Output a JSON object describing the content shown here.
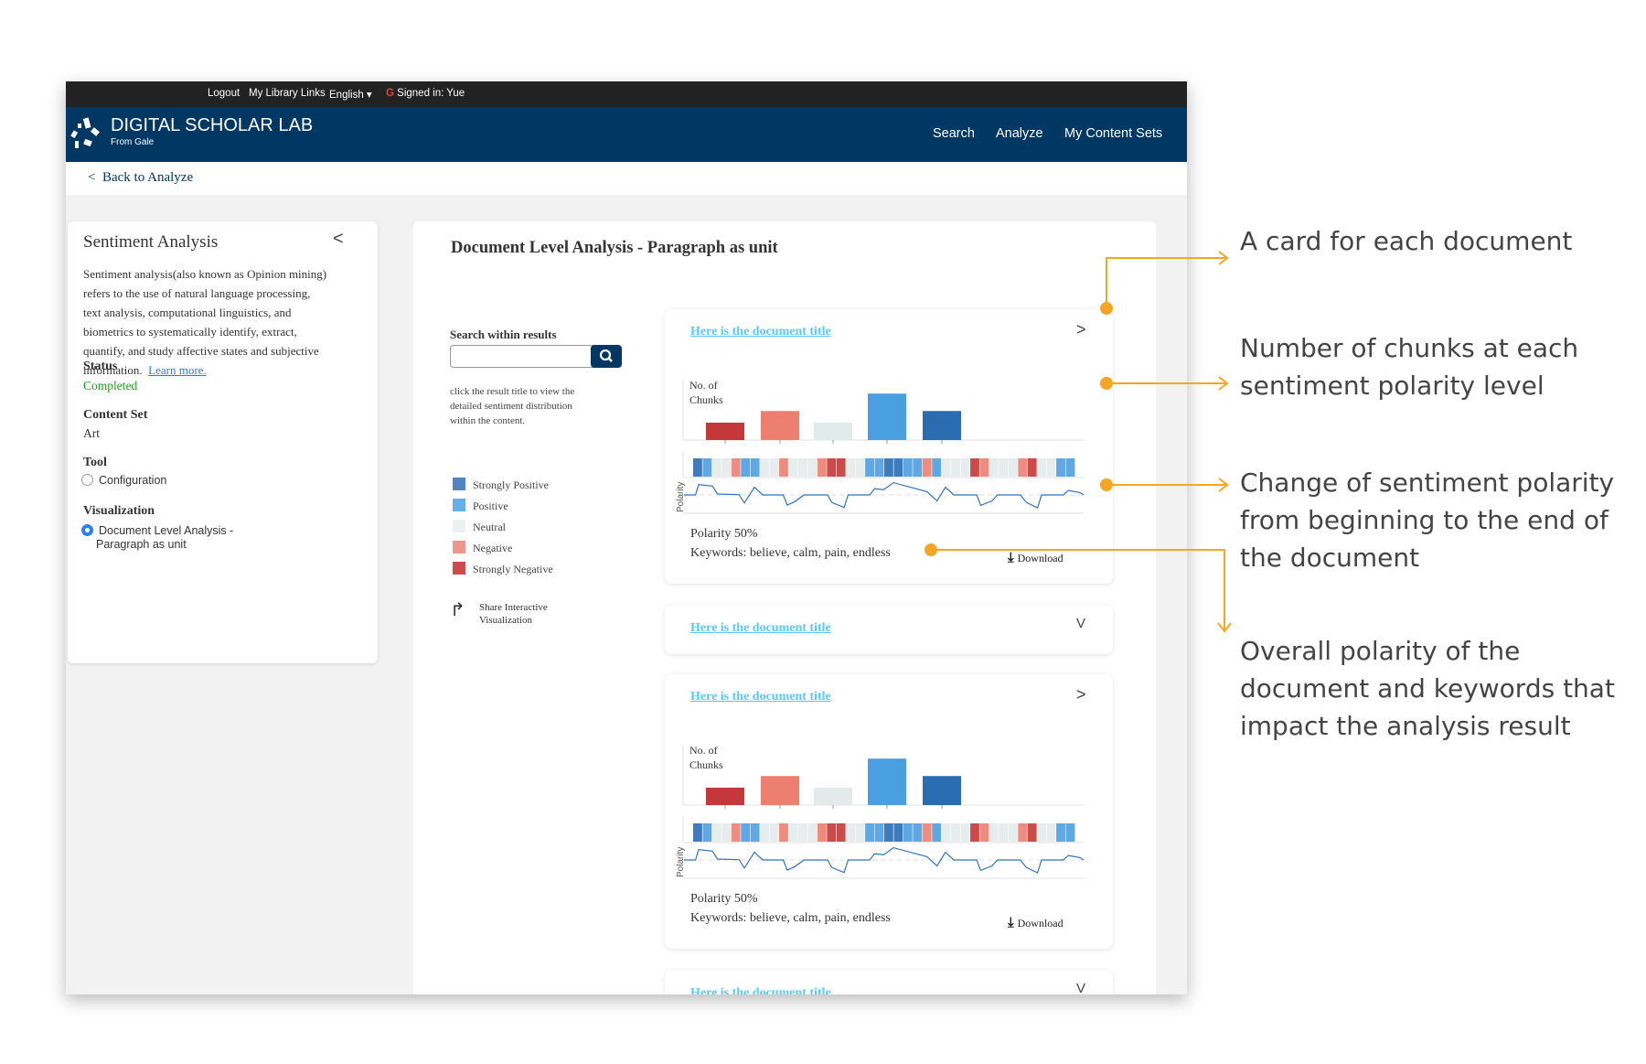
{
  "topbar": {
    "logout": "Logout",
    "library_links": "My Library Links",
    "language": "English",
    "signed_in": "Signed in: Yue"
  },
  "header": {
    "brand": "DIGITAL SCHOLAR LAB",
    "sub": "From Gale",
    "nav": [
      "Search",
      "Analyze",
      "My Content Sets"
    ]
  },
  "back": {
    "label": "Back to Analyze",
    "icon": "chevron-left-icon"
  },
  "left_panel": {
    "title": "Sentiment Analysis",
    "description_lines": [
      "Sentiment analysis(also known as Opinion mining)",
      "refers to the use of natural language processing,",
      "text analysis, computational linguistics, and",
      "biometrics to systematically identify, extract,",
      "quantify, and study affective states and subjective",
      "information."
    ],
    "learn_more": "Learn more.",
    "status_label": "Status",
    "status_value": "Completed",
    "status_color": "#1a9e1a",
    "content_set_label": "Content Set",
    "content_set_value": "Art",
    "tool_label": "Tool",
    "tool_option": "Configuration",
    "visualization_label": "Visualization",
    "visualization_option_line1": "Document Level Analysis -",
    "visualization_option_line2": "Paragraph as unit"
  },
  "main": {
    "title": "Document Level Analysis - Paragraph as unit",
    "search_label": "Search within results",
    "search_value": "",
    "search_placeholder": "",
    "help_lines": [
      "click the result title to view the",
      "detailed sentiment distribution",
      "within the content."
    ],
    "legend": [
      {
        "label": "Strongly Positive",
        "color": "#4f86c2"
      },
      {
        "label": "Positive",
        "color": "#66b0ea"
      },
      {
        "label": "Neutral",
        "color": "#ebf0f0"
      },
      {
        "label": "Negative",
        "color": "#f0958a"
      },
      {
        "label": "Strongly Negative",
        "color": "#cc4b4b"
      }
    ],
    "share_line1": "Share Interactive",
    "share_line2": "Visualization"
  },
  "documents": [
    {
      "title": "Here is the document title",
      "expanded": true,
      "chevron": ">",
      "polarity": "Polarity 50%",
      "keywords": "Keywords: believe, calm, pain, endless",
      "download": "Download"
    },
    {
      "title": "Here is the document title",
      "expanded": false,
      "chevron": "V"
    },
    {
      "title": "Here is the document title",
      "expanded": true,
      "chevron": ">",
      "polarity": "Polarity 50%",
      "keywords": "Keywords: believe, calm, pain, endless",
      "download": "Download"
    },
    {
      "title": "Here is the document title",
      "expanded": false,
      "chevron": "V"
    }
  ],
  "chart_data": [
    {
      "type": "bar",
      "ylabel": "No. of Chunks",
      "categories": [
        "Strongly Negative",
        "Negative",
        "Neutral",
        "Positive",
        "Strongly Positive"
      ],
      "values": [
        3,
        5,
        3,
        8,
        5
      ],
      "colors": [
        "#c4373a",
        "#ec7f6f",
        "#e2eaea",
        "#4a9fe0",
        "#2a6cb0"
      ]
    },
    {
      "type": "heatmap",
      "categories": [
        "SP",
        "P",
        "N",
        "N",
        "Neg",
        "P",
        "P",
        "N",
        "N",
        "Neg",
        "N",
        "N",
        "N",
        "Neg",
        "SN",
        "SN",
        "N",
        "N",
        "P",
        "P",
        "SP",
        "SP",
        "P",
        "P",
        "Neg",
        "P",
        "N",
        "N",
        "N",
        "SN",
        "Neg",
        "N",
        "N",
        "N",
        "Neg",
        "SN",
        "N",
        "N",
        "P",
        "P"
      ],
      "colors": {
        "SP": "#3f7cbc",
        "P": "#5fa8e3",
        "N": "#e7eded",
        "Neg": "#ef8c80",
        "SN": "#cc4a4a"
      }
    },
    {
      "type": "line",
      "ylabel": "Polarity",
      "ylim": [
        -1.2,
        1.2
      ],
      "color": "#2f72c0",
      "points": [
        [
          0.2,
          0
        ],
        [
          3.1,
          0
        ],
        [
          3.9,
          0.88
        ],
        [
          7.3,
          0.75
        ],
        [
          8.6,
          0.08
        ],
        [
          14,
          0.02
        ],
        [
          15.3,
          -0.68
        ],
        [
          17.8,
          0.65
        ],
        [
          19.9,
          0
        ],
        [
          25,
          0
        ],
        [
          26,
          -0.85
        ],
        [
          27.7,
          -0.6
        ],
        [
          30.2,
          0
        ],
        [
          36.1,
          0
        ],
        [
          37.1,
          -0.63
        ],
        [
          40.2,
          -1.05
        ],
        [
          41.2,
          0
        ],
        [
          46.6,
          0
        ],
        [
          47.8,
          0.53
        ],
        [
          50.1,
          0.45
        ],
        [
          52.5,
          1.03
        ],
        [
          60.9,
          0.28
        ],
        [
          63.4,
          -0.5
        ],
        [
          65.5,
          0.65
        ],
        [
          67.6,
          0
        ],
        [
          73.3,
          0
        ],
        [
          74.3,
          -0.88
        ],
        [
          77.1,
          -0.5
        ],
        [
          78.5,
          0
        ],
        [
          84.2,
          0
        ],
        [
          85.7,
          -0.63
        ],
        [
          88.5,
          -1.08
        ],
        [
          89.5,
          0
        ],
        [
          94.9,
          0
        ],
        [
          96.2,
          0.38
        ],
        [
          99.1,
          0.2
        ],
        [
          100,
          0
        ]
      ]
    }
  ],
  "annotations": {
    "accent": "#f5a623",
    "card": [
      "A card for each document"
    ],
    "chunks": [
      "Number of chunks at each",
      "sentiment polarity level"
    ],
    "change": [
      "Change of sentiment polarity",
      "from beginning to the end of",
      "the document"
    ],
    "overall": [
      "Overall polarity of the",
      "document and keywords that",
      "impact the analysis result"
    ]
  }
}
